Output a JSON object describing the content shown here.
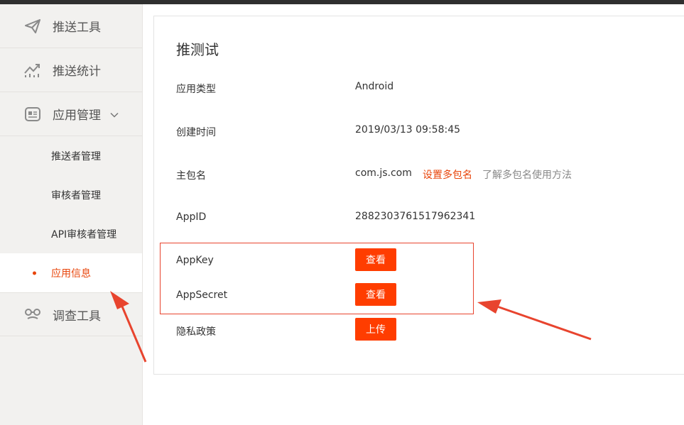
{
  "sidebar": {
    "items": [
      {
        "label": "推送工具",
        "icon": "paper-plane-icon"
      },
      {
        "label": "推送统计",
        "icon": "trend-chart-icon"
      },
      {
        "label": "应用管理",
        "icon": "app-card-icon",
        "expanded": true
      },
      {
        "label": "调查工具",
        "icon": "survey-glasses-icon"
      }
    ],
    "sub_items": [
      {
        "label": "推送者管理"
      },
      {
        "label": "审核者管理"
      },
      {
        "label": "API审核者管理"
      },
      {
        "label": "应用信息",
        "active": true
      }
    ]
  },
  "main": {
    "title": "推测试",
    "rows": {
      "app_type": {
        "label": "应用类型",
        "value": "Android"
      },
      "created": {
        "label": "创建时间",
        "value": "2019/03/13 09:58:45"
      },
      "package": {
        "label": "主包名",
        "value": "com.js.com",
        "set_link": "设置多包名",
        "help_link": "了解多包名使用方法"
      },
      "app_id": {
        "label": "AppID",
        "value": "2882303761517962341"
      },
      "app_key": {
        "label": "AppKey",
        "button": "查看"
      },
      "app_secret": {
        "label": "AppSecret",
        "button": "查看"
      },
      "privacy": {
        "label": "隐私政策",
        "button": "上传"
      }
    }
  },
  "colors": {
    "accent": "#ff3d00",
    "active_text": "#e8440a",
    "annotation": "#e8442e",
    "sidebar_bg": "#f2f1ef"
  }
}
